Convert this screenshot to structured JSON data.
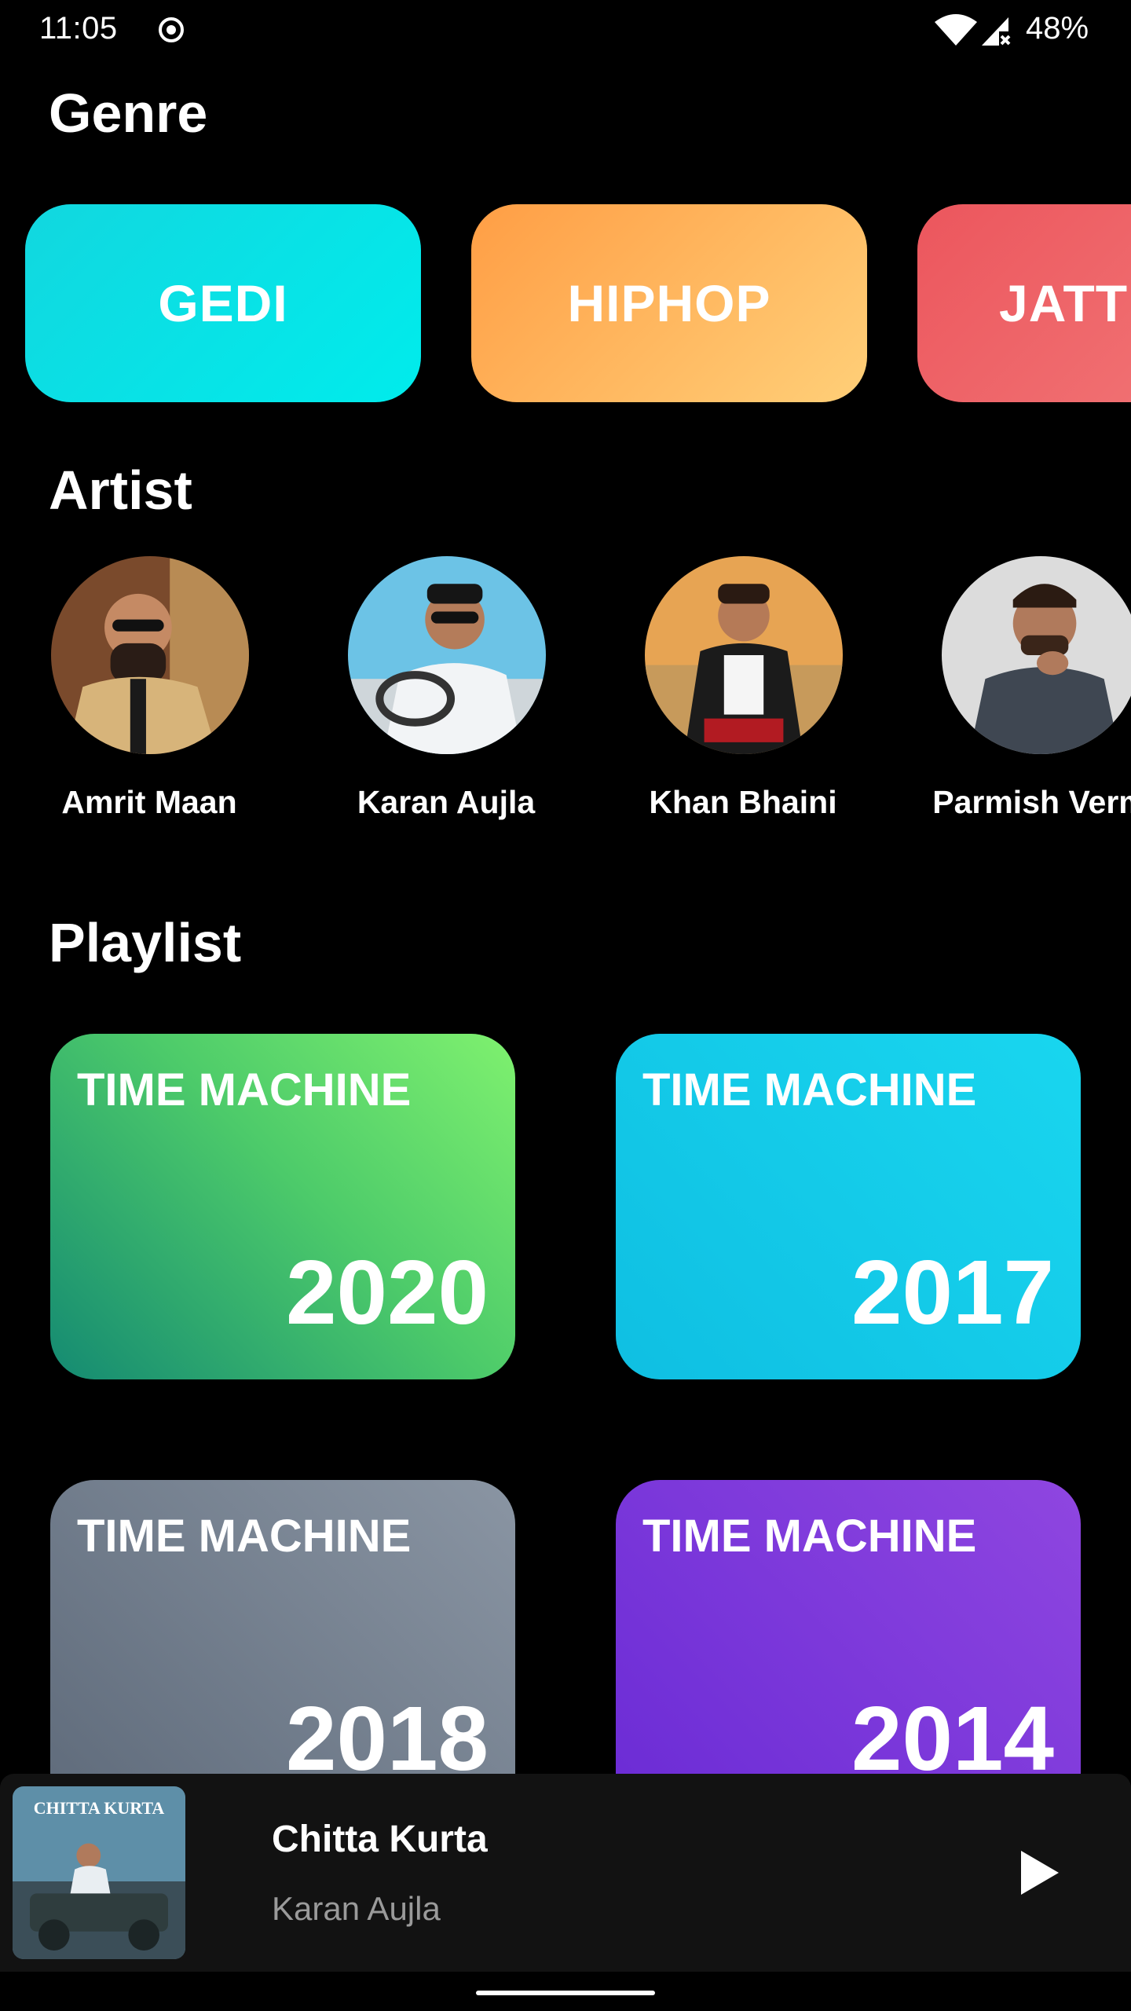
{
  "status_bar": {
    "time": "11:05",
    "battery": "48%",
    "icons": [
      "record-icon",
      "wifi-icon",
      "cell-signal-icon"
    ]
  },
  "sections": {
    "genre": "Genre",
    "artist": "Artist",
    "playlist": "Playlist"
  },
  "genres": [
    {
      "label": "GEDI",
      "color": "#00e5e5"
    },
    {
      "label": "HIPHOP",
      "color": "#ffb65c"
    },
    {
      "label": "JATT",
      "color": "#ee6269"
    }
  ],
  "artists": [
    {
      "name": "Amrit Maan"
    },
    {
      "name": "Karan Aujla"
    },
    {
      "name": "Khan Bhaini"
    },
    {
      "name": "Parmish Verm"
    }
  ],
  "playlists": [
    {
      "label": "TIME MACHINE",
      "year": "2020",
      "color": "#4dcb6a"
    },
    {
      "label": "TIME MACHINE",
      "year": "2017",
      "color": "#19d6ef"
    },
    {
      "label": "TIME MACHINE",
      "year": "2018",
      "color": "#7a8594"
    },
    {
      "label": "TIME MACHINE",
      "year": "2014",
      "color": "#7c3adb"
    }
  ],
  "now_playing": {
    "title": "Chitta Kurta",
    "artist": "Karan Aujla",
    "art_text": "CHITTA KURTA"
  }
}
